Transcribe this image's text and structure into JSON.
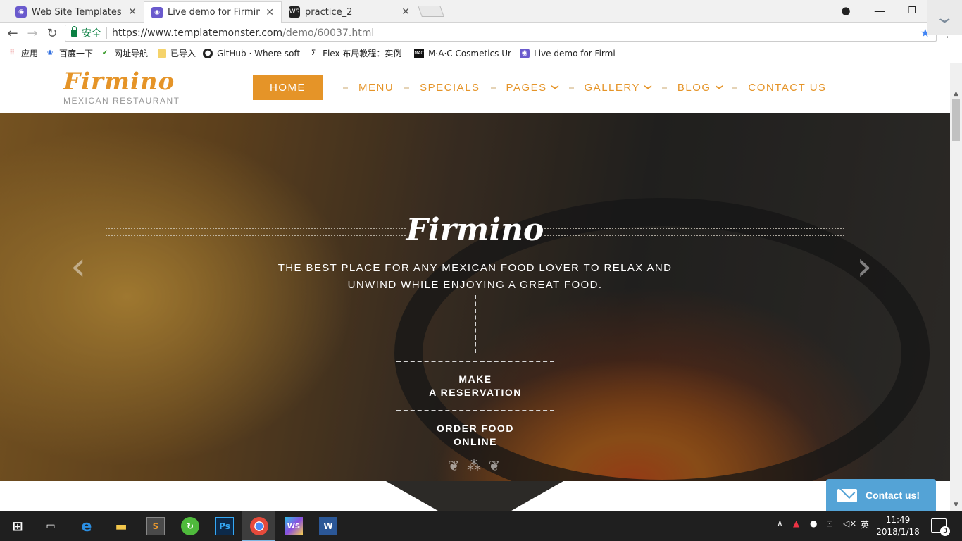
{
  "browser": {
    "tabs": [
      {
        "title": "Web Site Templates | V",
        "icon": "templatemonster-icon"
      },
      {
        "title": "Live demo for Firmino",
        "icon": "templatemonster-icon",
        "active": true
      },
      {
        "title": "practice_2",
        "icon": "webstorm-icon"
      }
    ],
    "address": {
      "secure_label": "安全",
      "url_host": "https://www.templatemonster.com",
      "url_path": "/demo/60037.html"
    },
    "bookmarks": [
      {
        "label": "应用",
        "icon": "apps-grid-icon"
      },
      {
        "label": "百度一下",
        "icon": "baidu-paw-icon"
      },
      {
        "label": "网址导航",
        "icon": "hao123-icon"
      },
      {
        "label": "已导入",
        "icon": "folder-icon"
      },
      {
        "label": "GitHub · Where soft",
        "icon": "github-icon"
      },
      {
        "label": "Flex 布局教程：实例",
        "icon": "flex-icon"
      },
      {
        "label": "M·A·C Cosmetics Ur",
        "icon": "mac-icon"
      },
      {
        "label": "Live demo for Firmi",
        "icon": "templatemonster-icon"
      }
    ]
  },
  "site": {
    "logo": "Firmino",
    "logo_sub": "MEXICAN RESTAURANT",
    "nav": [
      {
        "label": "HOME",
        "active": true,
        "dropdown": false
      },
      {
        "label": "MENU",
        "dropdown": false
      },
      {
        "label": "SPECIALS",
        "dropdown": false
      },
      {
        "label": "PAGES",
        "dropdown": true
      },
      {
        "label": "GALLERY",
        "dropdown": true
      },
      {
        "label": "BLOG",
        "dropdown": true
      },
      {
        "label": "CONTACT US",
        "dropdown": false
      }
    ],
    "accent": "#e59428"
  },
  "hero": {
    "title": "Firmino",
    "text_line1": "THE BEST PLACE FOR ANY MEXICAN FOOD LOVER TO RELAX AND",
    "text_line2": "UNWIND WHILE ENJOYING A GREAT FOOD.",
    "cta1_line1": "MAKE",
    "cta1_line2": "A RESERVATION",
    "cta2_line1": "ORDER FOOD",
    "cta2_line2": "ONLINE"
  },
  "contact_widget": {
    "label": "Contact us!",
    "color": "#54a3d6"
  },
  "taskbar": {
    "apps": [
      "windows-start-icon",
      "task-view-icon",
      "edge-icon",
      "file-explorer-icon",
      "sublime-icon",
      "green-app-icon",
      "photoshop-icon",
      "chrome-icon",
      "webstorm-icon",
      "word-icon"
    ],
    "ime": "英",
    "time": "11:49",
    "date": "2018/1/18",
    "notifications": "3"
  }
}
